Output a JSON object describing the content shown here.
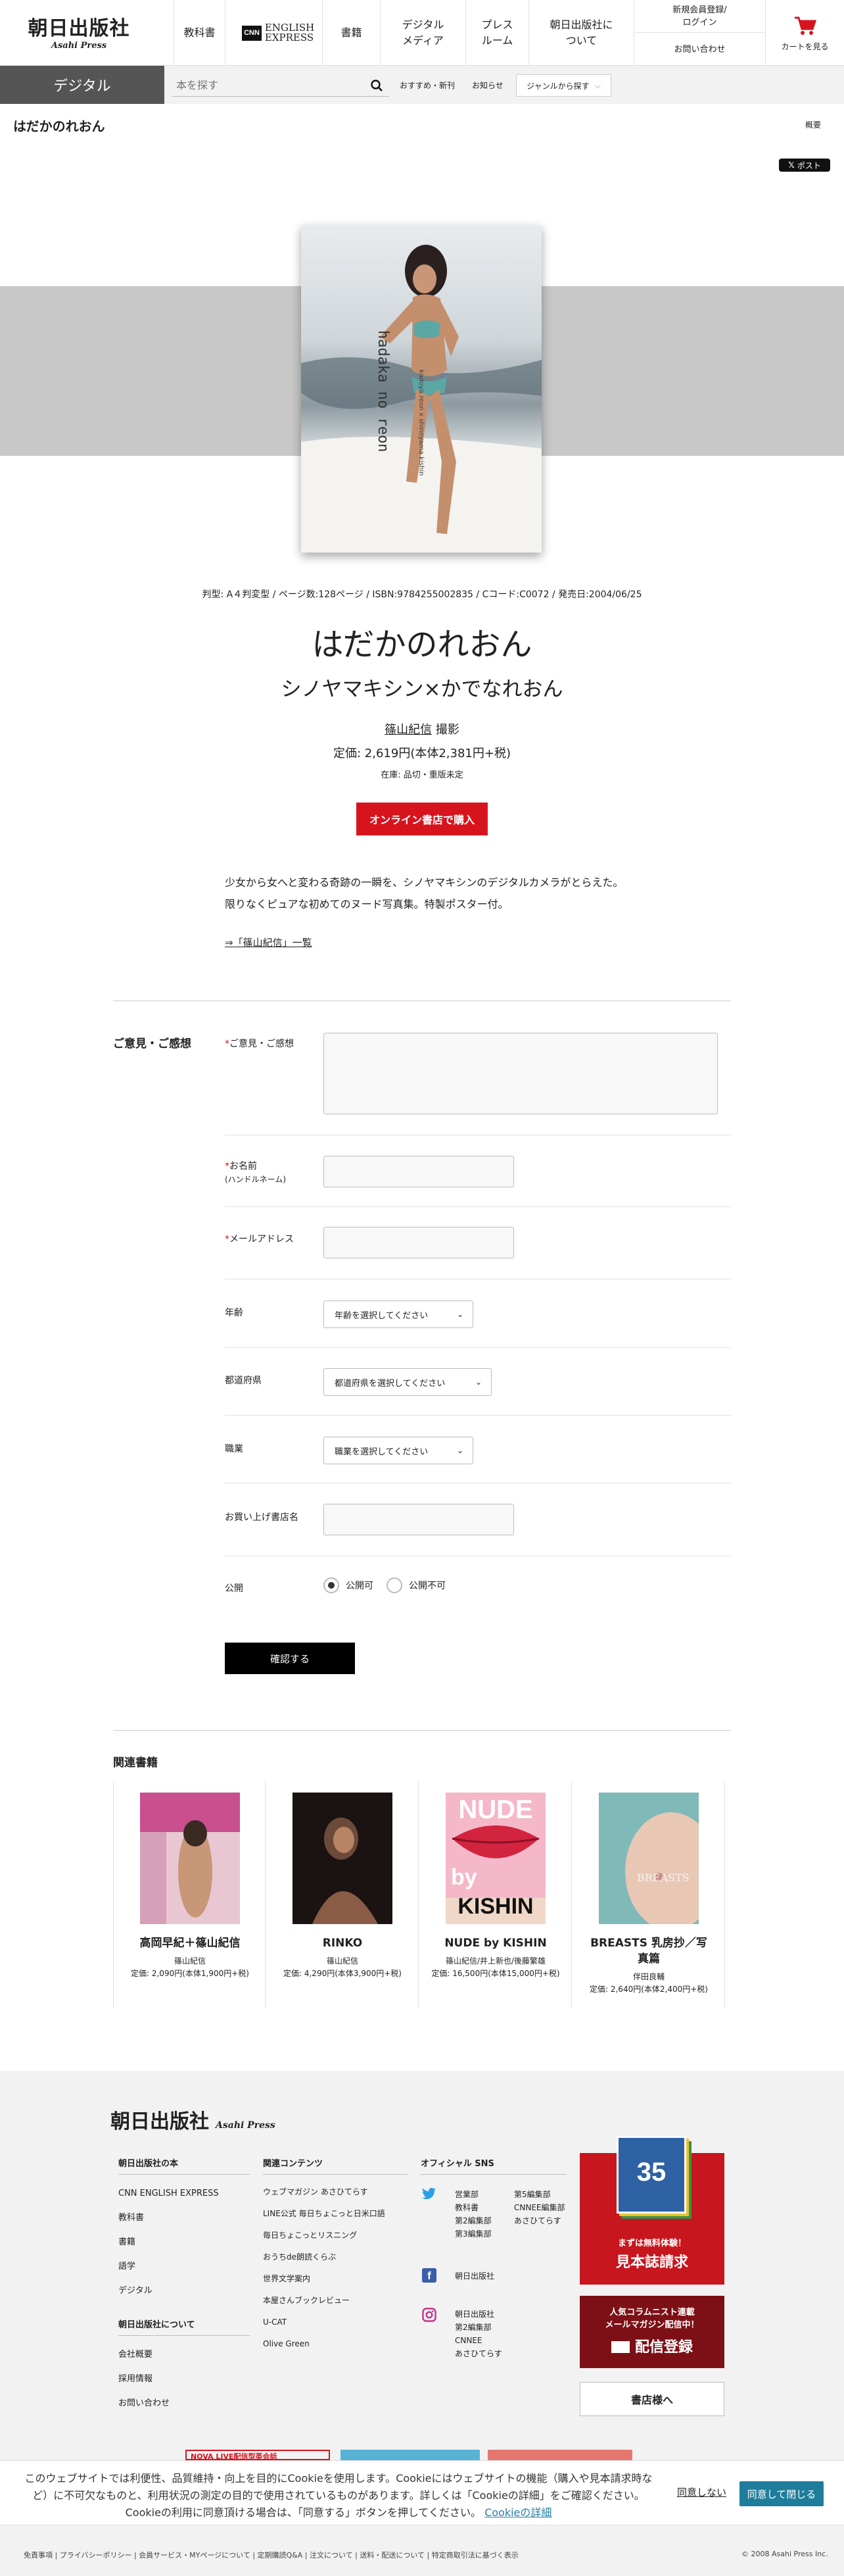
{
  "header": {
    "logo_jp": "朝日出版社",
    "logo_en": "Asahi Press",
    "nav": [
      "教科書",
      "ENGLISH EXPRESS",
      "書籍",
      "デジタル\nメディア",
      "プレス\nルーム",
      "朝日出版社に\nついて"
    ],
    "cnn": "CNN",
    "member": "新規会員登録/\nログイン",
    "contact": "お問い合わせ",
    "cart": "カートを見る"
  },
  "subbar": {
    "tab": "デジタル",
    "search_placeholder": "本を探す",
    "links": [
      "おすすめ・新刊",
      "お知らせ"
    ],
    "genre": "ジャンルから探す"
  },
  "page": {
    "title": "はだかのれおん",
    "overview": "概要",
    "xpost": "ポスト"
  },
  "book": {
    "cover_text": "hadaka no reon",
    "cover_sub": "kadoya reon x shinoyama kishin",
    "meta": "判型: A４判変型 / ページ数:128ページ / ISBN:9784255002835 / Cコード:C0072 / 発売日:2004/06/25",
    "title": "はだかのれおん",
    "subtitle": "シノヤマキシン×かでなれおん",
    "author": "篠山紀信",
    "author_role": "撮影",
    "price": "定価: 2,619円(本体2,381円+税)",
    "stock": "在庫: 品切・重版未定",
    "buy": "オンライン書店で購入",
    "desc": [
      "少女から女へと変わる奇跡の一瞬を、シノヤマキシンのデジタルカメラがとらえた。",
      "限りなくピュアな初めてのヌード写真集。特製ポスター付。"
    ],
    "more": "⇒「篠山紀信」一覧"
  },
  "form": {
    "section": "ご意見・ご感想",
    "req": "*",
    "comment": "ご意見・ご感想",
    "name": "お名前",
    "name_note": "(ハンドルネーム)",
    "email": "メールアドレス",
    "age": "年齢",
    "age_select": "年齢を選択してください",
    "pref": "都道府県",
    "pref_select": "都道府県を選択してください",
    "job": "職業",
    "job_select": "職業を選択してください",
    "store": "お買い上げ書店名",
    "public": "公開",
    "public_yes": "公開可",
    "public_no": "公開不可",
    "confirm": "確認する"
  },
  "related": {
    "title": "関連書籍",
    "items": [
      {
        "title": "高岡早紀＋篠山紀信",
        "author": "篠山紀信",
        "price": "定価: 2,090円(本体1,900円+税)",
        "colors": [
          "#c94f8e",
          "#e6b6c5"
        ]
      },
      {
        "title": "RINKO",
        "author": "篠山紀信",
        "price": "定価: 4,290円(本体3,900円+税)",
        "colors": [
          "#1b1212",
          "#6c4a3a"
        ]
      },
      {
        "title": "NUDE by KISHIN",
        "author": "篠山紀信/井上新也/後藤繁雄",
        "price": "定価: 16,500円(本体15,000円+税)",
        "colors": [
          "#f2a0b8",
          "#d2233f"
        ],
        "cover_top": "NUDE",
        "cover_mid": "by",
        "cover_bot": "KISHIN"
      },
      {
        "title": "BREASTS 乳房抄／写真篇",
        "author": "伴田良輔",
        "price": "定価: 2,640円(本体2,400円+税)",
        "colors": [
          "#7fb9b8",
          "#e8c7b5"
        ],
        "cover_top": "BREASTS"
      }
    ]
  },
  "footer": {
    "logo_jp": "朝日出版社",
    "logo_en": "Asahi Press",
    "col1_h": "朝日出版社の本",
    "col1": [
      "CNN ENGLISH EXPRESS",
      "教科書",
      "書籍",
      "語学",
      "デジタル"
    ],
    "col1b_h": "朝日出版社について",
    "col1b": [
      "会社概要",
      "採用情報",
      "お問い合わせ"
    ],
    "col2_h": "関連コンテンツ",
    "col2": [
      "ウェブマガジン あさひてらす",
      "LINE公式 毎日ちょこっと日米口語",
      "毎日ちょこっとリスニング",
      "おうちde朗読くらぶ",
      "世界文学案内",
      "本屋さんブックレビュー",
      "U-CAT",
      "Olive Green"
    ],
    "col3_h": "オフィシャル SNS",
    "tw_a": [
      "営業部",
      "教科書",
      "第2編集部",
      "第3編集部"
    ],
    "tw_b": [
      "第5編集部",
      "CNNEE編集部",
      "あさひてらす"
    ],
    "fb": [
      "朝日出版社"
    ],
    "ig": [
      "朝日出版社",
      "第2編集部",
      "CNNEE",
      "あさひてらす"
    ],
    "mag_top": "35",
    "mag_l1": "まずは無料体験！",
    "mag_l2": "見本誌請求",
    "mm_l1": "人気コラムニスト連載",
    "mm_l2": "メールマガジン配信中！",
    "mm_l3": "配信登録",
    "shop": "書店様へ",
    "ads": [
      "NOVA LIVE配信型英会話",
      "",
      ""
    ]
  },
  "cookie": {
    "text1": "このウェブサイトでは利便性、品質維持・向上を目的にCookieを使用します。Cookieにはウェブサイトの機能（購入や見本請求時な",
    "text2": "ど）に不可欠なものと、利用状況の測定の目的で使用されているものがあります。詳しくは「Cookieの詳細」をご確認ください。",
    "text3": "Cookieの利用に同意頂ける場合は、「同意する」ボタンを押してください。",
    "link": "Cookieの詳細",
    "deny": "同意しない",
    "agree": "同意して閉じる"
  },
  "bottom": {
    "links": "免責事項 | プライバシーポリシー | 会員サービス・MYページについて | 定期購読Q&A | 注文について | 送料・配送について | 特定商取引法に基づく表示",
    "copy": "© 2008 Asahi Press Inc."
  }
}
